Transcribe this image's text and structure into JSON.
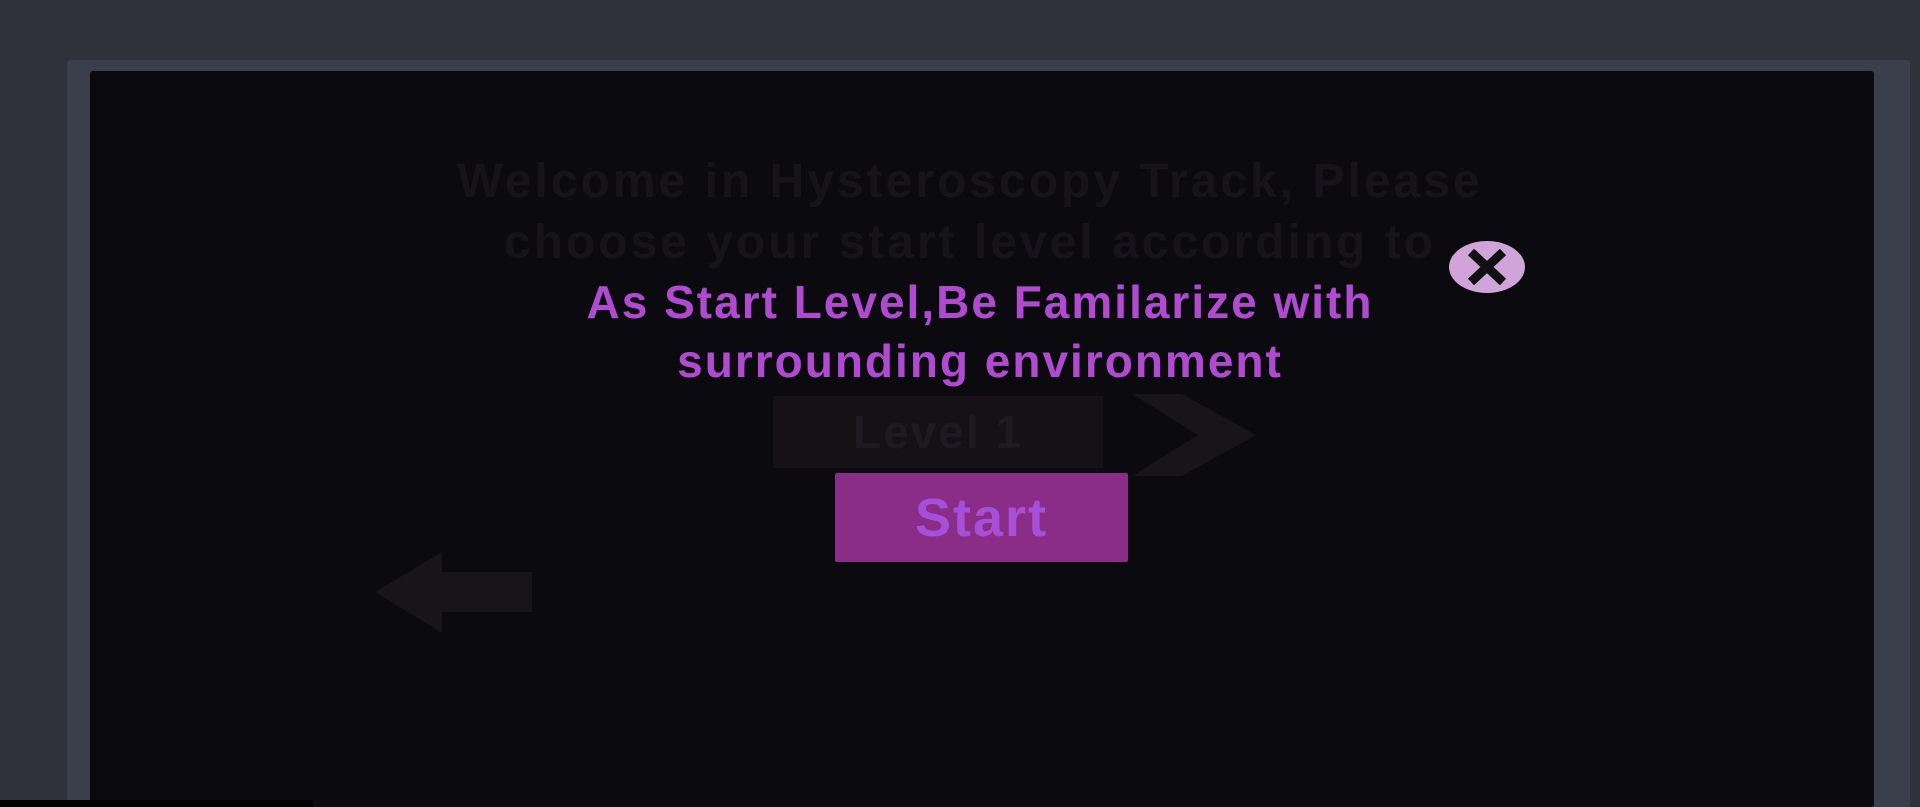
{
  "background": {
    "title": "Welcome in Hysteroscopy Track, Please\nchoose your start level according to",
    "level_label": "Level 1"
  },
  "modal": {
    "message": "As Start Level,Be Familarize with\nsurrounding environment",
    "start_label": "Start",
    "close_icon": "close-icon"
  },
  "icons": {
    "next": "chevron-right-icon",
    "back": "arrow-left-icon"
  },
  "colors": {
    "page_bg": "#2f323b",
    "frame_bg": "#3b3f4c",
    "game_bg": "#0b0b0f",
    "accent_text": "#b04bd1",
    "start_button_bg": "#8a2d86",
    "close_button_bg": "#d0a4d8"
  }
}
